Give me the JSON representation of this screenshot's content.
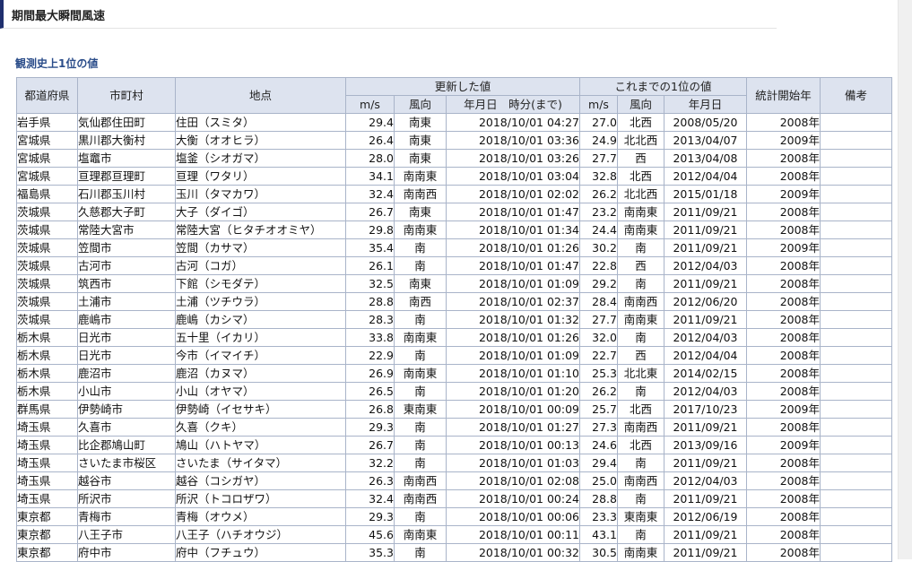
{
  "page_title": "期間最大瞬間風速",
  "section_title": "観測史上1位の値",
  "table": {
    "headers": {
      "pref": "都道府県",
      "city": "市町村",
      "point": "地点",
      "updated": "更新した値",
      "previous": "これまでの1位の値",
      "start_year": "統計開始年",
      "remarks": "備考",
      "ms": "m/s",
      "direction": "風向",
      "date_time": "年月日　時分(まで)",
      "date": "年月日"
    },
    "rows": [
      {
        "pref": "岩手県",
        "city": "気仙郡住田町",
        "point": "住田（スミタ）",
        "speed": "29.4",
        "dir": "南東",
        "datetime": "2018/10/01 04:27",
        "prev_speed": "27.0",
        "prev_dir": "北西",
        "prev_date": "2008/05/20",
        "start": "2008年",
        "remarks": ""
      },
      {
        "pref": "宮城県",
        "city": "黒川郡大衡村",
        "point": "大衡（オオヒラ）",
        "speed": "26.4",
        "dir": "南東",
        "datetime": "2018/10/01 03:36",
        "prev_speed": "24.9",
        "prev_dir": "北北西",
        "prev_date": "2013/04/07",
        "start": "2009年",
        "remarks": ""
      },
      {
        "pref": "宮城県",
        "city": "塩竈市",
        "point": "塩釜（シオガマ）",
        "speed": "28.0",
        "dir": "南東",
        "datetime": "2018/10/01 03:26",
        "prev_speed": "27.7",
        "prev_dir": "西",
        "prev_date": "2013/04/08",
        "start": "2008年",
        "remarks": ""
      },
      {
        "pref": "宮城県",
        "city": "亘理郡亘理町",
        "point": "亘理（ワタリ）",
        "speed": "34.1",
        "dir": "南南東",
        "datetime": "2018/10/01 03:04",
        "prev_speed": "32.8",
        "prev_dir": "北西",
        "prev_date": "2012/04/04",
        "start": "2008年",
        "remarks": ""
      },
      {
        "pref": "福島県",
        "city": "石川郡玉川村",
        "point": "玉川（タマカワ）",
        "speed": "32.4",
        "dir": "南南西",
        "datetime": "2018/10/01 02:02",
        "prev_speed": "26.2",
        "prev_dir": "北北西",
        "prev_date": "2015/01/18",
        "start": "2009年",
        "remarks": ""
      },
      {
        "pref": "茨城県",
        "city": "久慈郡大子町",
        "point": "大子（ダイゴ）",
        "speed": "26.7",
        "dir": "南東",
        "datetime": "2018/10/01 01:47",
        "prev_speed": "23.2",
        "prev_dir": "南南東",
        "prev_date": "2011/09/21",
        "start": "2008年",
        "remarks": ""
      },
      {
        "pref": "茨城県",
        "city": "常陸大宮市",
        "point": "常陸大宮（ヒタチオオミヤ）",
        "speed": "29.8",
        "dir": "南南東",
        "datetime": "2018/10/01 01:34",
        "prev_speed": "24.4",
        "prev_dir": "南南東",
        "prev_date": "2011/09/21",
        "start": "2008年",
        "remarks": ""
      },
      {
        "pref": "茨城県",
        "city": "笠間市",
        "point": "笠間（カサマ）",
        "speed": "35.4",
        "dir": "南",
        "datetime": "2018/10/01 01:26",
        "prev_speed": "30.2",
        "prev_dir": "南",
        "prev_date": "2011/09/21",
        "start": "2009年",
        "remarks": ""
      },
      {
        "pref": "茨城県",
        "city": "古河市",
        "point": "古河（コガ）",
        "speed": "26.1",
        "dir": "南",
        "datetime": "2018/10/01 01:47",
        "prev_speed": "22.8",
        "prev_dir": "西",
        "prev_date": "2012/04/03",
        "start": "2008年",
        "remarks": ""
      },
      {
        "pref": "茨城県",
        "city": "筑西市",
        "point": "下館（シモダテ）",
        "speed": "32.5",
        "dir": "南東",
        "datetime": "2018/10/01 01:09",
        "prev_speed": "29.2",
        "prev_dir": "南",
        "prev_date": "2011/09/21",
        "start": "2008年",
        "remarks": ""
      },
      {
        "pref": "茨城県",
        "city": "土浦市",
        "point": "土浦（ツチウラ）",
        "speed": "28.8",
        "dir": "南西",
        "datetime": "2018/10/01 02:37",
        "prev_speed": "28.4",
        "prev_dir": "南南西",
        "prev_date": "2012/06/20",
        "start": "2008年",
        "remarks": ""
      },
      {
        "pref": "茨城県",
        "city": "鹿嶋市",
        "point": "鹿嶋（カシマ）",
        "speed": "28.3",
        "dir": "南",
        "datetime": "2018/10/01 01:32",
        "prev_speed": "27.7",
        "prev_dir": "南南東",
        "prev_date": "2011/09/21",
        "start": "2008年",
        "remarks": ""
      },
      {
        "pref": "栃木県",
        "city": "日光市",
        "point": "五十里（イカリ）",
        "speed": "33.8",
        "dir": "南南東",
        "datetime": "2018/10/01 01:26",
        "prev_speed": "32.0",
        "prev_dir": "南",
        "prev_date": "2012/04/03",
        "start": "2008年",
        "remarks": ""
      },
      {
        "pref": "栃木県",
        "city": "日光市",
        "point": "今市（イマイチ）",
        "speed": "22.9",
        "dir": "南",
        "datetime": "2018/10/01 01:09",
        "prev_speed": "22.7",
        "prev_dir": "西",
        "prev_date": "2012/04/04",
        "start": "2008年",
        "remarks": ""
      },
      {
        "pref": "栃木県",
        "city": "鹿沼市",
        "point": "鹿沼（カヌマ）",
        "speed": "26.9",
        "dir": "南南東",
        "datetime": "2018/10/01 01:10",
        "prev_speed": "25.3",
        "prev_dir": "北北東",
        "prev_date": "2014/02/15",
        "start": "2008年",
        "remarks": ""
      },
      {
        "pref": "栃木県",
        "city": "小山市",
        "point": "小山（オヤマ）",
        "speed": "26.5",
        "dir": "南",
        "datetime": "2018/10/01 01:20",
        "prev_speed": "26.2",
        "prev_dir": "南",
        "prev_date": "2012/04/03",
        "start": "2008年",
        "remarks": ""
      },
      {
        "pref": "群馬県",
        "city": "伊勢崎市",
        "point": "伊勢崎（イセサキ）",
        "speed": "26.8",
        "dir": "東南東",
        "datetime": "2018/10/01 00:09",
        "prev_speed": "25.7",
        "prev_dir": "北西",
        "prev_date": "2017/10/23",
        "start": "2009年",
        "remarks": ""
      },
      {
        "pref": "埼玉県",
        "city": "久喜市",
        "point": "久喜（クキ）",
        "speed": "29.3",
        "dir": "南",
        "datetime": "2018/10/01 01:27",
        "prev_speed": "27.3",
        "prev_dir": "南南西",
        "prev_date": "2011/09/21",
        "start": "2008年",
        "remarks": ""
      },
      {
        "pref": "埼玉県",
        "city": "比企郡鳩山町",
        "point": "鳩山（ハトヤマ）",
        "speed": "26.7",
        "dir": "南",
        "datetime": "2018/10/01 00:13",
        "prev_speed": "24.6",
        "prev_dir": "北西",
        "prev_date": "2013/09/16",
        "start": "2009年",
        "remarks": ""
      },
      {
        "pref": "埼玉県",
        "city": "さいたま市桜区",
        "point": "さいたま（サイタマ）",
        "speed": "32.2",
        "dir": "南",
        "datetime": "2018/10/01 01:03",
        "prev_speed": "29.4",
        "prev_dir": "南",
        "prev_date": "2011/09/21",
        "start": "2008年",
        "remarks": ""
      },
      {
        "pref": "埼玉県",
        "city": "越谷市",
        "point": "越谷（コシガヤ）",
        "speed": "26.3",
        "dir": "南南西",
        "datetime": "2018/10/01 02:08",
        "prev_speed": "25.0",
        "prev_dir": "南南西",
        "prev_date": "2012/04/03",
        "start": "2008年",
        "remarks": ""
      },
      {
        "pref": "埼玉県",
        "city": "所沢市",
        "point": "所沢（トコロザワ）",
        "speed": "32.4",
        "dir": "南南西",
        "datetime": "2018/10/01 00:24",
        "prev_speed": "28.8",
        "prev_dir": "南",
        "prev_date": "2011/09/21",
        "start": "2008年",
        "remarks": ""
      },
      {
        "pref": "東京都",
        "city": "青梅市",
        "point": "青梅（オウメ）",
        "speed": "29.3",
        "dir": "南",
        "datetime": "2018/10/01 00:06",
        "prev_speed": "23.3",
        "prev_dir": "東南東",
        "prev_date": "2012/06/19",
        "start": "2008年",
        "remarks": ""
      },
      {
        "pref": "東京都",
        "city": "八王子市",
        "point": "八王子（ハチオウジ）",
        "speed": "45.6",
        "dir": "南南東",
        "datetime": "2018/10/01 00:11",
        "prev_speed": "43.1",
        "prev_dir": "南",
        "prev_date": "2011/09/21",
        "start": "2008年",
        "remarks": ""
      },
      {
        "pref": "東京都",
        "city": "府中市",
        "point": "府中（フチュウ）",
        "speed": "35.3",
        "dir": "南",
        "datetime": "2018/10/01 00:32",
        "prev_speed": "30.5",
        "prev_dir": "南南東",
        "prev_date": "2011/09/21",
        "start": "2008年",
        "remarks": ""
      }
    ]
  }
}
